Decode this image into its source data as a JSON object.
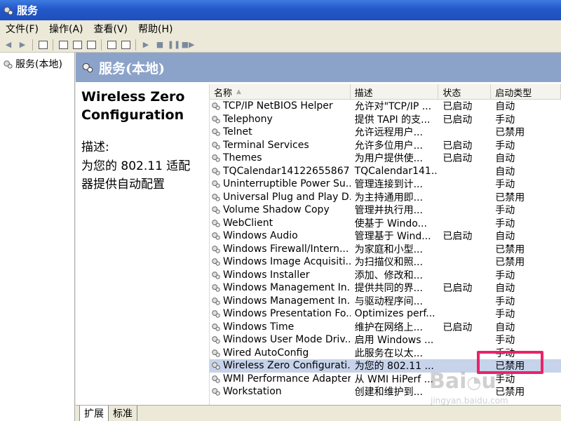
{
  "window": {
    "title": "服务"
  },
  "menu": [
    "文件(F)",
    "操作(A)",
    "查看(V)",
    "帮助(H)"
  ],
  "tree": {
    "root_label": "服务(本地)"
  },
  "header": {
    "title": "服务(本地)"
  },
  "description_pane": {
    "service_name": "Wireless Zero Configuration",
    "desc_label": "描述:",
    "desc_text": "为您的 802.11 适配器提供自动配置"
  },
  "columns": {
    "name": "名称",
    "description": "描述",
    "status": "状态",
    "startup": "启动类型"
  },
  "rows": [
    {
      "name": "TCP/IP NetBIOS Helper",
      "description": "允许对\"TCP/IP ...",
      "status": "已启动",
      "startup": "自动"
    },
    {
      "name": "Telephony",
      "description": "提供 TAPI 的支...",
      "status": "已启动",
      "startup": "手动"
    },
    {
      "name": "Telnet",
      "description": "允许远程用户...",
      "status": "",
      "startup": "已禁用"
    },
    {
      "name": "Terminal Services",
      "description": "允许多位用户...",
      "status": "已启动",
      "startup": "手动"
    },
    {
      "name": "Themes",
      "description": "为用户提供使...",
      "status": "已启动",
      "startup": "自动"
    },
    {
      "name": "TQCalendar14122655867...",
      "description": "TQCalendar141...",
      "status": "",
      "startup": "自动"
    },
    {
      "name": "Uninterruptible Power Su...",
      "description": "管理连接到计...",
      "status": "",
      "startup": "手动"
    },
    {
      "name": "Universal Plug and Play D...",
      "description": "为主持通用即...",
      "status": "",
      "startup": "已禁用"
    },
    {
      "name": "Volume Shadow Copy",
      "description": "管理并执行用...",
      "status": "",
      "startup": "手动"
    },
    {
      "name": "WebClient",
      "description": "使基于 Windo...",
      "status": "",
      "startup": "手动"
    },
    {
      "name": "Windows Audio",
      "description": "管理基于 Wind...",
      "status": "已启动",
      "startup": "自动"
    },
    {
      "name": "Windows Firewall/Intern...",
      "description": "为家庭和小型...",
      "status": "",
      "startup": "已禁用"
    },
    {
      "name": "Windows Image Acquisiti...",
      "description": "为扫描仪和照...",
      "status": "",
      "startup": "已禁用"
    },
    {
      "name": "Windows Installer",
      "description": "添加、修改和...",
      "status": "",
      "startup": "手动"
    },
    {
      "name": "Windows Management In...",
      "description": "提供共同的界...",
      "status": "已启动",
      "startup": "自动"
    },
    {
      "name": "Windows Management In...",
      "description": "与驱动程序间...",
      "status": "",
      "startup": "手动"
    },
    {
      "name": "Windows Presentation Fo...",
      "description": "Optimizes perf...",
      "status": "",
      "startup": "手动"
    },
    {
      "name": "Windows Time",
      "description": "维护在网络上...",
      "status": "已启动",
      "startup": "自动"
    },
    {
      "name": "Windows User Mode Driv...",
      "description": "启用 Windows ...",
      "status": "",
      "startup": "手动"
    },
    {
      "name": "Wired AutoConfig",
      "description": "此服务在以太...",
      "status": "",
      "startup": "手动"
    },
    {
      "name": "Wireless Zero Configurati...",
      "description": "为您的 802.11 ...",
      "status": "",
      "startup": "已禁用",
      "selected": true
    },
    {
      "name": "WMI Performance Adapter",
      "description": "从 WMI HiPerf ...",
      "status": "",
      "startup": "手动"
    },
    {
      "name": "Workstation",
      "description": "创建和维护到...",
      "status": "",
      "startup": "已禁用"
    }
  ],
  "tabs": [
    "扩展",
    "标准"
  ],
  "watermark": {
    "brand": "Baidu",
    "sub": "jingyan.baidu.com"
  },
  "colors": {
    "titlebar": "#2457c7",
    "header_strip": "#8ca3c9",
    "selected_row": "#c6d3ea",
    "highlight": "#e8236a"
  }
}
